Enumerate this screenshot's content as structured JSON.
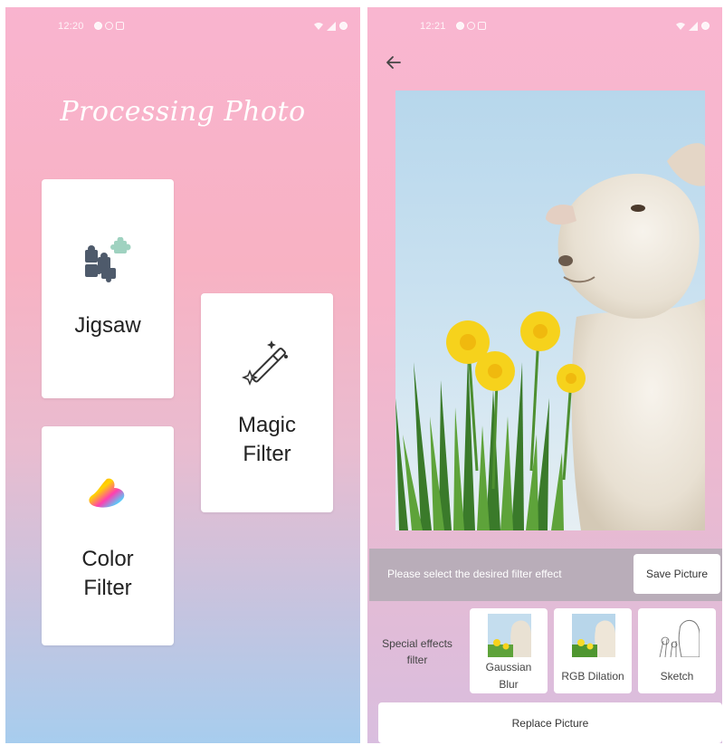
{
  "left_screen": {
    "status_bar": {
      "time": "12:20"
    },
    "title": "Processing Photo",
    "cards": {
      "jigsaw": {
        "label": "Jigsaw",
        "icon": "puzzle-icon"
      },
      "magic_filter": {
        "label_line1": "Magic",
        "label_line2": "Filter",
        "icon": "magic-wand-icon"
      },
      "color_filter": {
        "label_line1": "Color",
        "label_line2": "Filter",
        "icon": "color-blob-icon"
      }
    }
  },
  "right_screen": {
    "status_bar": {
      "time": "12:21"
    },
    "back_icon": "back-arrow-icon",
    "filter_bar": {
      "prompt": "Please select the desired filter effect",
      "save_button": "Save Picture"
    },
    "special_effects": {
      "label_line1": "Special effects",
      "label_line2": "filter",
      "options": [
        {
          "label_line1": "Gaussian",
          "label_line2": "Blur"
        },
        {
          "label_line1": "RGB Dilation"
        },
        {
          "label_line1": "Sketch"
        }
      ]
    },
    "replace_button": "Replace Picture"
  },
  "colors": {
    "gradient_top": "#f9b4cf",
    "gradient_bottom": "#a7cdee",
    "card_bg": "#ffffff",
    "filter_bar_bg": "#b9adb9"
  }
}
